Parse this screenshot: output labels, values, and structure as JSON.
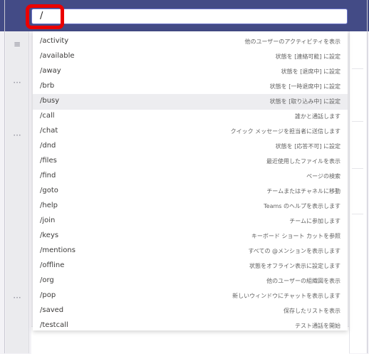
{
  "search": {
    "value": "/"
  },
  "commands": [
    {
      "name": "/activity",
      "description": "他のユーザーのアクティビティを表示"
    },
    {
      "name": "/available",
      "description": "状態を [連絡可能] に設定"
    },
    {
      "name": "/away",
      "description": "状態を [退席中] に設定"
    },
    {
      "name": "/brb",
      "description": "状態を [一時退席中] に設定"
    },
    {
      "name": "/busy",
      "description": "状態を [取り込み中] に設定"
    },
    {
      "name": "/call",
      "description": "誰かと通話します"
    },
    {
      "name": "/chat",
      "description": "クイック メッセージを担当者に送信します"
    },
    {
      "name": "/dnd",
      "description": "状態を [応答不可] に設定"
    },
    {
      "name": "/files",
      "description": "最近使用したファイルを表示"
    },
    {
      "name": "/find",
      "description": "ページの検索"
    },
    {
      "name": "/goto",
      "description": "チームまたはチャネルに移動"
    },
    {
      "name": "/help",
      "description": "Teams のヘルプを表示します"
    },
    {
      "name": "/join",
      "description": "チームに参加します"
    },
    {
      "name": "/keys",
      "description": "キーボード ショート カットを参照"
    },
    {
      "name": "/mentions",
      "description": "すべての @メンションを表示します"
    },
    {
      "name": "/offline",
      "description": "状態をオフライン表示に設定します"
    },
    {
      "name": "/org",
      "description": "他のユーザーの組織図を表示"
    },
    {
      "name": "/pop",
      "description": "新しいウィンドウにチャットを表示します"
    },
    {
      "name": "/saved",
      "description": "保存したリストを表示"
    },
    {
      "name": "/testcall",
      "description": "テスト通話を開始"
    }
  ],
  "selected_command": "/busy",
  "colors": {
    "title_bar": "#434b86",
    "highlight_border": "#ea0000",
    "search_border": "#6b74c8",
    "selected_row": "#ededf0"
  },
  "icons": {
    "rail_top": "filter-icon",
    "rail_more": "more-options-icon"
  }
}
